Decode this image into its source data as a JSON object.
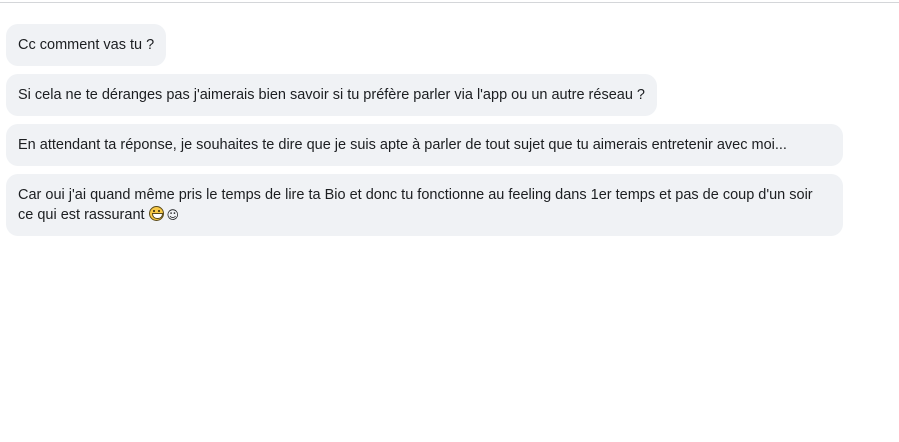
{
  "messages": [
    {
      "text": "Cc comment vas tu ?"
    },
    {
      "text": "Si cela ne te déranges pas j'aimerais bien savoir si tu préfère parler via l'app ou un autre réseau ?"
    },
    {
      "text": "En attendant ta réponse, je souhaites te dire que je suis apte à parler de tout sujet que tu aimerais entretenir avec moi..."
    },
    {
      "text": "Car oui j'ai quand même pris le temps de lire ta Bio et donc tu fonctionne au feeling dans 1er temps et pas de coup d'un soir ce qui est rassurant",
      "emojis": [
        "grinning-squinting-face-icon",
        "☺"
      ]
    }
  ],
  "colors": {
    "bubble_background": "#f0f2f5",
    "text": "#1c1e21",
    "divider": "#d4d6d9"
  }
}
